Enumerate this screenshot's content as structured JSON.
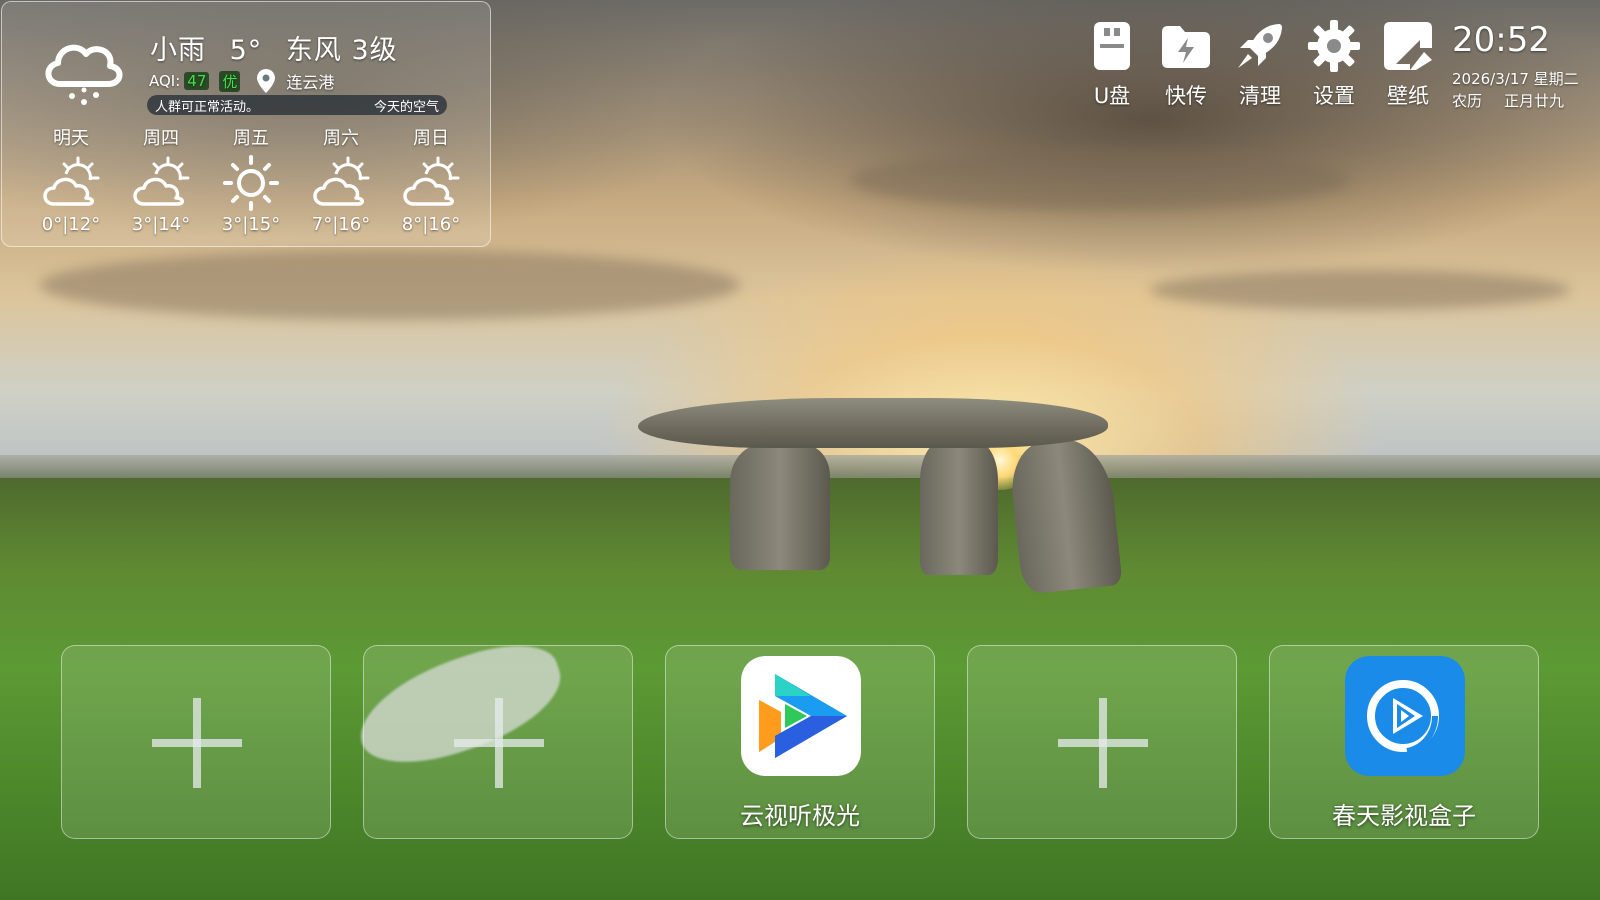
{
  "weather": {
    "condition": "小雨",
    "temperature": "5°",
    "wind": "东风 3级",
    "aqi_label": "AQI:",
    "aqi_value": "47",
    "aqi_level": "优",
    "city": "连云港",
    "advice": "人群可正常活动。",
    "advice_title": "今天的空气",
    "forecast": [
      {
        "day": "明天",
        "temp": "0°|12°",
        "icon": "partly-cloudy-icon"
      },
      {
        "day": "周四",
        "temp": "3°|14°",
        "icon": "partly-cloudy-icon"
      },
      {
        "day": "周五",
        "temp": "3°|15°",
        "icon": "sunny-icon"
      },
      {
        "day": "周六",
        "temp": "7°|16°",
        "icon": "partly-cloudy-icon"
      },
      {
        "day": "周日",
        "temp": "8°|16°",
        "icon": "partly-cloudy-icon"
      }
    ]
  },
  "toolbar": {
    "items": [
      {
        "label": "U盘",
        "icon": "usb-drive-icon"
      },
      {
        "label": "快传",
        "icon": "quick-transfer-icon"
      },
      {
        "label": "清理",
        "icon": "rocket-cleanup-icon"
      },
      {
        "label": "设置",
        "icon": "gear-icon"
      },
      {
        "label": "壁纸",
        "icon": "wallpaper-icon"
      }
    ]
  },
  "clock": {
    "time": "20:52",
    "date": "2026/3/17 星期二",
    "lunar_label": "农历",
    "lunar_date": "正月廿九"
  },
  "apps": [
    {
      "type": "add",
      "label": ""
    },
    {
      "type": "add",
      "label": ""
    },
    {
      "type": "app",
      "label": "云视听极光",
      "icon": "yunshiting-jiguang-app-icon",
      "color": "#ffffff"
    },
    {
      "type": "add",
      "label": ""
    },
    {
      "type": "app",
      "label": "春天影视盒子",
      "icon": "chuntian-video-box-app-icon",
      "color": "#1a8be8"
    }
  ]
}
